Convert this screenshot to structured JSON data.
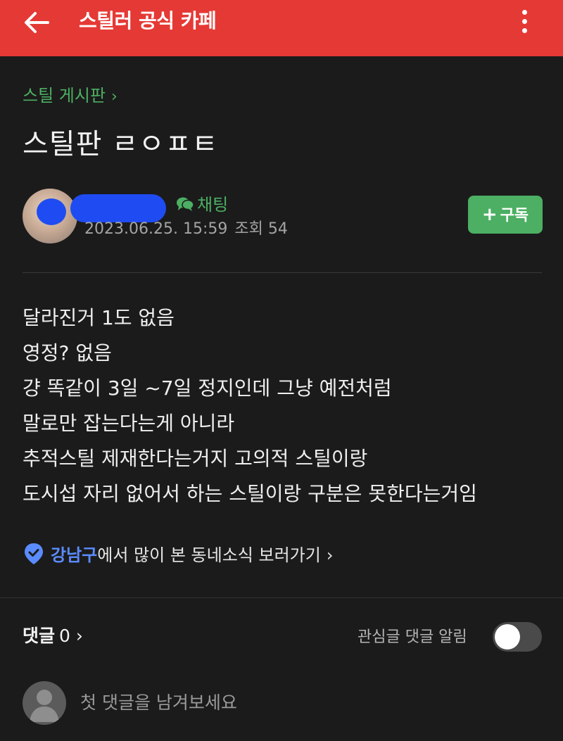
{
  "header": {
    "back_icon": "arrow-left-icon",
    "title": "스틸러 공식 카페",
    "more_icon": "more-vertical-icon",
    "background_color": "#e53935"
  },
  "board": {
    "breadcrumb": "스틸 게시판",
    "chevron": "›"
  },
  "post": {
    "title": "스틸판 ㄹㅇㅍㅌ",
    "author": {
      "chat_label": "채팅",
      "date": "2023.06.25. 15:59",
      "views": "조회 54"
    },
    "subscribe": {
      "plus": "+",
      "label": "구독"
    },
    "body_lines": [
      "달라진거 1도 없음",
      "영정? 없음",
      "걍 똑같이 3일 ~7일 정지인데 그냥 예전처럼",
      "말로만 잡는다는게 아니라",
      "추적스틸 제재한다는거지 고의적 스틸이랑",
      "도시섭 자리 없어서 하는 스틸이랑 구분은 못한다는거임"
    ]
  },
  "local_news": {
    "place": "강남구",
    "text": "에서 많이 본 동네소식 보러가기",
    "chevron": "›"
  },
  "comments": {
    "label": "댓글",
    "count": "0",
    "chevron": "›",
    "notify_label": "관심글 댓글 알림",
    "notify_on": false,
    "input_placeholder": "첫 댓글을 남겨보세요"
  },
  "colors": {
    "accent_green": "#4caf63",
    "place_blue": "#5b8cff",
    "background": "#1b1b1b"
  }
}
